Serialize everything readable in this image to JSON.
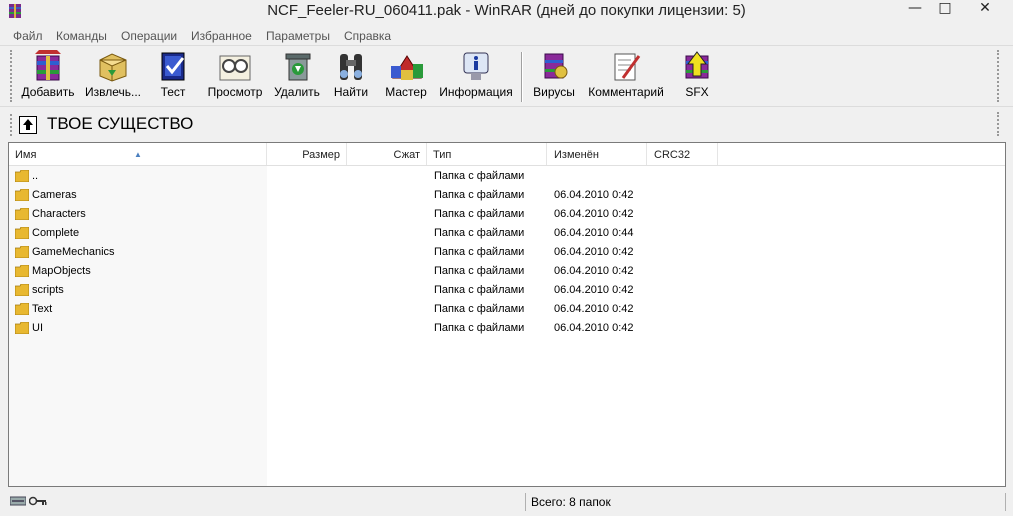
{
  "window": {
    "title": "NCF_Feeler-RU_060411.pak - WinRAR (дней до покупки лицензии: 5)",
    "minimize": "—",
    "maximize": "□",
    "close": "✕"
  },
  "menu": [
    "Файл",
    "Команды",
    "Операции",
    "Избранное",
    "Параметры",
    "Справка"
  ],
  "toolbar": {
    "buttons": [
      {
        "label": "Добавить",
        "icon": "add-archive-icon"
      },
      {
        "label": "Извлечь...",
        "icon": "extract-icon"
      },
      {
        "label": "Тест",
        "icon": "test-icon"
      },
      {
        "label": "Просмотр",
        "icon": "view-icon"
      },
      {
        "label": "Удалить",
        "icon": "delete-icon"
      },
      {
        "label": "Найти",
        "icon": "find-icon"
      },
      {
        "label": "Мастер",
        "icon": "wizard-icon"
      },
      {
        "label": "Информация",
        "icon": "info-icon"
      },
      {
        "label": "Вирусы",
        "icon": "virus-scan-icon"
      },
      {
        "label": "Комментарий",
        "icon": "comment-icon"
      },
      {
        "label": "SFX",
        "icon": "sfx-icon"
      }
    ]
  },
  "address": {
    "path": "ТВОЕ СУЩЕСТВО",
    "icon": "up-folder-icon"
  },
  "columns": [
    "Имя",
    "Размер",
    "Сжат",
    "Тип",
    "Изменён",
    "CRC32"
  ],
  "rows": [
    {
      "name": "..",
      "size": "",
      "packed": "",
      "type": "Папка с файлами",
      "modified": "",
      "crc": ""
    },
    {
      "name": "Cameras",
      "size": "",
      "packed": "",
      "type": "Папка с файлами",
      "modified": "06.04.2010 0:42",
      "crc": ""
    },
    {
      "name": "Characters",
      "size": "",
      "packed": "",
      "type": "Папка с файлами",
      "modified": "06.04.2010 0:42",
      "crc": ""
    },
    {
      "name": "Complete",
      "size": "",
      "packed": "",
      "type": "Папка с файлами",
      "modified": "06.04.2010 0:44",
      "crc": ""
    },
    {
      "name": "GameMechanics",
      "size": "",
      "packed": "",
      "type": "Папка с файлами",
      "modified": "06.04.2010 0:42",
      "crc": ""
    },
    {
      "name": "MapObjects",
      "size": "",
      "packed": "",
      "type": "Папка с файлами",
      "modified": "06.04.2010 0:42",
      "crc": ""
    },
    {
      "name": "scripts",
      "size": "",
      "packed": "",
      "type": "Папка с файлами",
      "modified": "06.04.2010 0:42",
      "crc": ""
    },
    {
      "name": "Text",
      "size": "",
      "packed": "",
      "type": "Папка с файлами",
      "modified": "06.04.2010 0:42",
      "crc": ""
    },
    {
      "name": "UI",
      "size": "",
      "packed": "",
      "type": "Папка с файлами",
      "modified": "06.04.2010 0:42",
      "crc": ""
    }
  ],
  "status": {
    "summary": "Всего: 8 папок"
  }
}
